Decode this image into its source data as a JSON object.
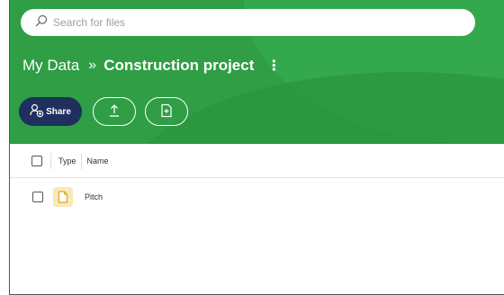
{
  "search": {
    "placeholder": "Search for files",
    "value": ""
  },
  "breadcrumb": {
    "root": "My Data",
    "separator": "»",
    "current": "Construction project",
    "more": "⋮"
  },
  "toolbar": {
    "share_label": "Share",
    "upload_icon": "upload-icon",
    "new_icon": "new-document-icon"
  },
  "table": {
    "columns": [
      "Type",
      "Name"
    ],
    "rows": [
      {
        "type_icon": "document-icon",
        "name": "Pitch"
      }
    ]
  },
  "colors": {
    "header_green": "#2f9e45",
    "share_button": "#1f2f5e",
    "file_icon_bg": "#fbe7b8"
  }
}
